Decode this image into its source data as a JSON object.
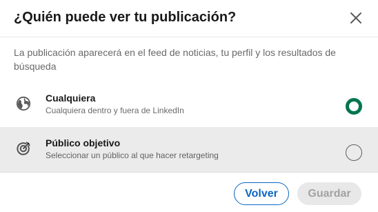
{
  "dialog": {
    "title": "¿Quién puede ver tu publicación?",
    "close_icon": "close-icon",
    "description": "La publicación aparecerá en el feed de noticias, tu perfil y los resultados de búsqueda"
  },
  "options": [
    {
      "icon": "globe-icon",
      "title": "Cualquiera",
      "subtitle": "Cualquiera dentro y fuera de LinkedIn",
      "selected": true
    },
    {
      "icon": "target-icon",
      "title": "Público objetivo",
      "subtitle": "Seleccionar un público al que hacer retargeting",
      "selected": false
    }
  ],
  "footer": {
    "back_label": "Volver",
    "save_label": "Guardar"
  },
  "colors": {
    "selected_radio": "#01754f",
    "primary": "#0a66c2",
    "disabled_bg": "#e8e8e8"
  }
}
